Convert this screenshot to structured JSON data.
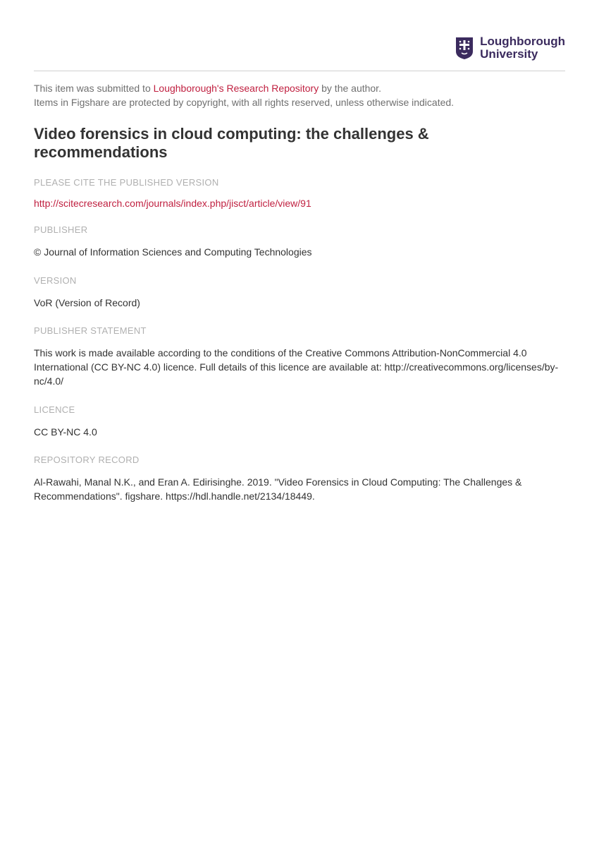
{
  "logo": {
    "line1": "Loughborough",
    "line2": "University"
  },
  "intro": {
    "prefix": "This item was submitted to ",
    "repo_link": "Loughborough's Research Repository",
    "suffix1": " by the author.",
    "line2": "Items in Figshare are protected by copyright, with all rights reserved, unless otherwise indicated."
  },
  "title": "Video forensics in cloud computing: the challenges & recommendations",
  "sections": {
    "cite_label": "PLEASE CITE THE PUBLISHED VERSION",
    "cite_url": "http://scitecresearch.com/journals/index.php/jisct/article/view/91",
    "publisher_label": "PUBLISHER",
    "publisher_value": "© Journal of Information Sciences and Computing Technologies",
    "version_label": "VERSION",
    "version_value": "VoR (Version of Record)",
    "statement_label": "PUBLISHER STATEMENT",
    "statement_value": "This work is made available according to the conditions of the Creative Commons Attribution-NonCommercial 4.0 International (CC BY-NC 4.0) licence. Full details of this licence are available at: http://creativecommons.org/licenses/by-nc/4.0/",
    "licence_label": "LICENCE",
    "licence_value": "CC BY-NC 4.0",
    "record_label": "REPOSITORY RECORD",
    "record_value": "Al-Rawahi, Manal N.K., and Eran A. Edirisinghe. 2019. \"Video Forensics in Cloud Computing: The Challenges & Recommendations\". figshare. https://hdl.handle.net/2134/18449."
  }
}
